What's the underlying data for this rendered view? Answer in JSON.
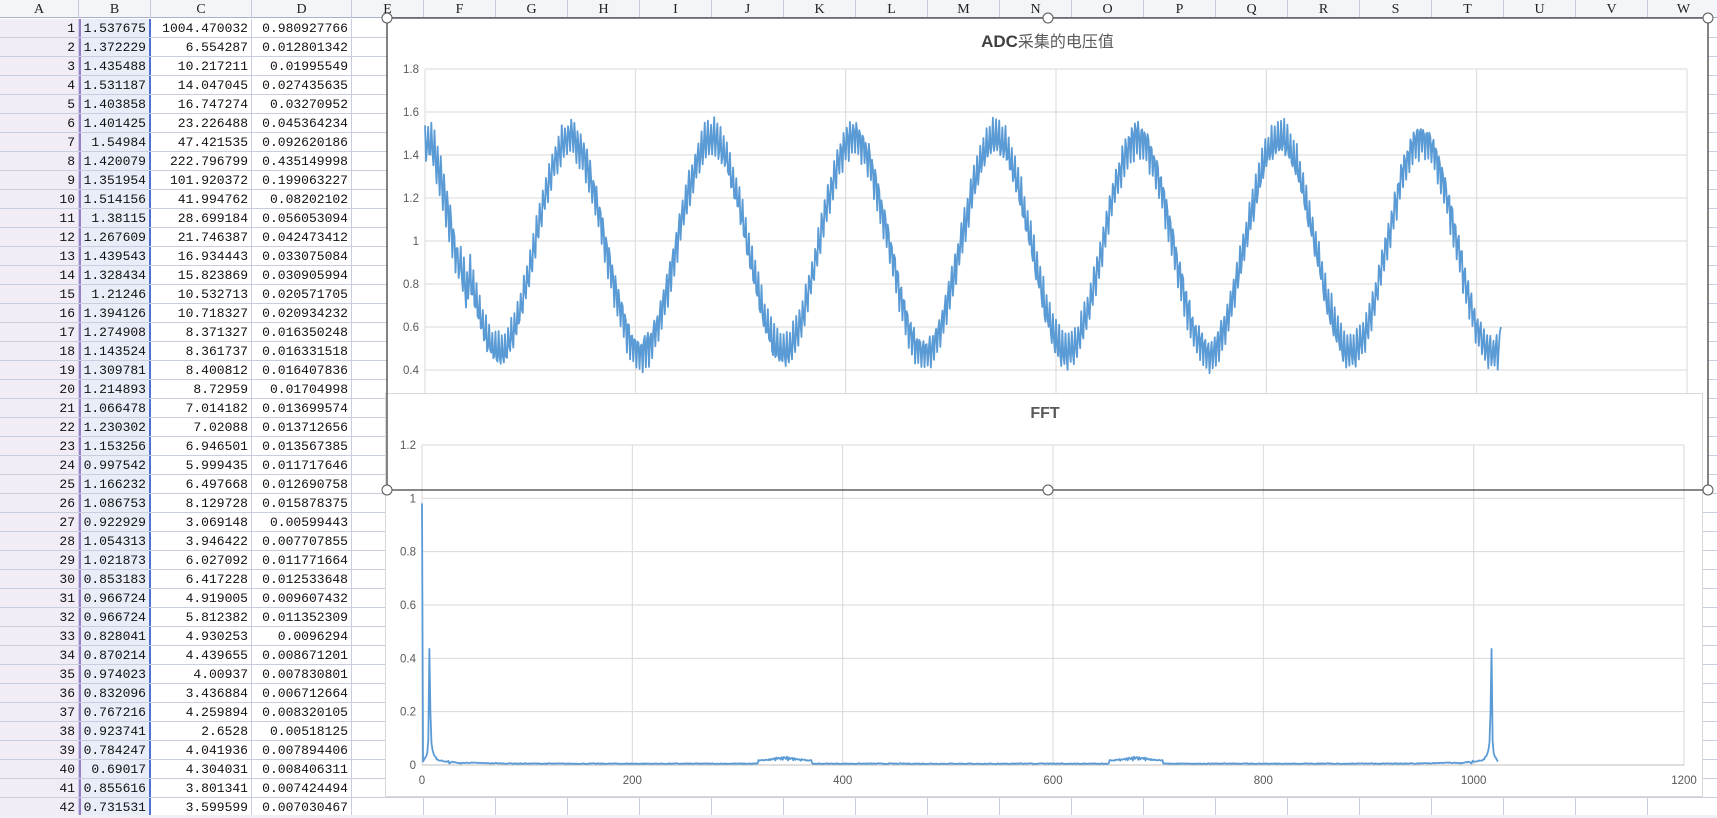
{
  "sheet": {
    "columns": [
      "A",
      "B",
      "C",
      "D",
      "E",
      "F",
      "G",
      "H",
      "I",
      "J",
      "K",
      "L",
      "M",
      "N",
      "O",
      "P",
      "Q",
      "R",
      "S",
      "T",
      "U",
      "V",
      "W"
    ],
    "rows": [
      {
        "n": "1",
        "b": "1.537675",
        "c": "1004.470032",
        "d": "0.980927766"
      },
      {
        "n": "2",
        "b": "1.372229",
        "c": "6.554287",
        "d": "0.012801342"
      },
      {
        "n": "3",
        "b": "1.435488",
        "c": "10.217211",
        "d": "0.01995549"
      },
      {
        "n": "4",
        "b": "1.531187",
        "c": "14.047045",
        "d": "0.027435635"
      },
      {
        "n": "5",
        "b": "1.403858",
        "c": "16.747274",
        "d": "0.03270952"
      },
      {
        "n": "6",
        "b": "1.401425",
        "c": "23.226488",
        "d": "0.045364234"
      },
      {
        "n": "7",
        "b": "1.54984",
        "c": "47.421535",
        "d": "0.092620186"
      },
      {
        "n": "8",
        "b": "1.420079",
        "c": "222.796799",
        "d": "0.435149998"
      },
      {
        "n": "9",
        "b": "1.351954",
        "c": "101.920372",
        "d": "0.199063227"
      },
      {
        "n": "10",
        "b": "1.514156",
        "c": "41.994762",
        "d": "0.08202102"
      },
      {
        "n": "11",
        "b": "1.38115",
        "c": "28.699184",
        "d": "0.056053094"
      },
      {
        "n": "12",
        "b": "1.267609",
        "c": "21.746387",
        "d": "0.042473412"
      },
      {
        "n": "13",
        "b": "1.439543",
        "c": "16.934443",
        "d": "0.033075084"
      },
      {
        "n": "14",
        "b": "1.328434",
        "c": "15.823869",
        "d": "0.030905994"
      },
      {
        "n": "15",
        "b": "1.21246",
        "c": "10.532713",
        "d": "0.020571705"
      },
      {
        "n": "16",
        "b": "1.394126",
        "c": "10.718327",
        "d": "0.020934232"
      },
      {
        "n": "17",
        "b": "1.274908",
        "c": "8.371327",
        "d": "0.016350248"
      },
      {
        "n": "18",
        "b": "1.143524",
        "c": "8.361737",
        "d": "0.016331518"
      },
      {
        "n": "19",
        "b": "1.309781",
        "c": "8.400812",
        "d": "0.016407836"
      },
      {
        "n": "20",
        "b": "1.214893",
        "c": "8.72959",
        "d": "0.01704998"
      },
      {
        "n": "21",
        "b": "1.066478",
        "c": "7.014182",
        "d": "0.013699574"
      },
      {
        "n": "22",
        "b": "1.230302",
        "c": "7.02088",
        "d": "0.013712656"
      },
      {
        "n": "23",
        "b": "1.153256",
        "c": "6.946501",
        "d": "0.013567385"
      },
      {
        "n": "24",
        "b": "0.997542",
        "c": "5.999435",
        "d": "0.011717646"
      },
      {
        "n": "25",
        "b": "1.166232",
        "c": "6.497668",
        "d": "0.012690758"
      },
      {
        "n": "26",
        "b": "1.086753",
        "c": "8.129728",
        "d": "0.015878375"
      },
      {
        "n": "27",
        "b": "0.922929",
        "c": "3.069148",
        "d": "0.00599443"
      },
      {
        "n": "28",
        "b": "1.054313",
        "c": "3.946422",
        "d": "0.007707855"
      },
      {
        "n": "29",
        "b": "1.021873",
        "c": "6.027092",
        "d": "0.011771664"
      },
      {
        "n": "30",
        "b": "0.853183",
        "c": "6.417228",
        "d": "0.012533648"
      },
      {
        "n": "31",
        "b": "0.966724",
        "c": "4.919005",
        "d": "0.009607432"
      },
      {
        "n": "32",
        "b": "0.966724",
        "c": "5.812382",
        "d": "0.011352309"
      },
      {
        "n": "33",
        "b": "0.828041",
        "c": "4.930253",
        "d": "0.0096294"
      },
      {
        "n": "34",
        "b": "0.870214",
        "c": "4.439655",
        "d": "0.008671201"
      },
      {
        "n": "35",
        "b": "0.974023",
        "c": "4.00937",
        "d": "0.007830801"
      },
      {
        "n": "36",
        "b": "0.832096",
        "c": "3.436884",
        "d": "0.006712664"
      },
      {
        "n": "37",
        "b": "0.767216",
        "c": "4.259894",
        "d": "0.008320105"
      },
      {
        "n": "38",
        "b": "0.923741",
        "c": "2.6528",
        "d": "0.00518125"
      },
      {
        "n": "39",
        "b": "0.784247",
        "c": "4.041936",
        "d": "0.007894406"
      },
      {
        "n": "40",
        "b": "0.69017",
        "c": "4.304031",
        "d": "0.008406311"
      },
      {
        "n": "41",
        "b": "0.855616",
        "c": "3.801341",
        "d": "0.007424494"
      },
      {
        "n": "42",
        "b": "0.731531",
        "c": "3.599599",
        "d": "0.007030467"
      }
    ]
  },
  "chart_data": [
    {
      "type": "line",
      "title_parts": [
        "ADC",
        "采集的电压值"
      ],
      "ylim": [
        0.2,
        1.8
      ],
      "yticks": [
        "1.8",
        "1.6",
        "1.4",
        "1.2",
        "1",
        "0.8",
        "0.6",
        "0.4"
      ],
      "xlim": [
        0,
        1200
      ],
      "x_grid_step": 200,
      "grid": true,
      "legend": "none",
      "color": "#5b9bd5",
      "source_column": "B",
      "point_count": 1024,
      "y_range_observed": [
        0.34,
        1.62
      ],
      "cycles_visible": 7.5
    },
    {
      "type": "line",
      "title": "FFT",
      "ylim": [
        0,
        1.2
      ],
      "yticks": [
        "1.2",
        "1",
        "0.8",
        "0.6",
        "0.4",
        "0.2",
        "0"
      ],
      "xlim": [
        0,
        1200
      ],
      "xticks": [
        "0",
        "200",
        "400",
        "600",
        "800",
        "1000",
        "1200"
      ],
      "grid": true,
      "legend": "none",
      "color": "#5b9bd5",
      "source_column": "D",
      "point_count": 1024,
      "peaks": [
        {
          "x": 0,
          "y": 0.98
        },
        {
          "x": 7,
          "y": 0.435
        },
        {
          "x": 1017,
          "y": 0.435
        }
      ],
      "minor_bumps": [
        {
          "x_from": 325,
          "x_to": 365,
          "y": 0.03
        },
        {
          "x_from": 659,
          "x_to": 699,
          "y": 0.03
        }
      ]
    }
  ],
  "selection": {
    "color": "#404040"
  }
}
